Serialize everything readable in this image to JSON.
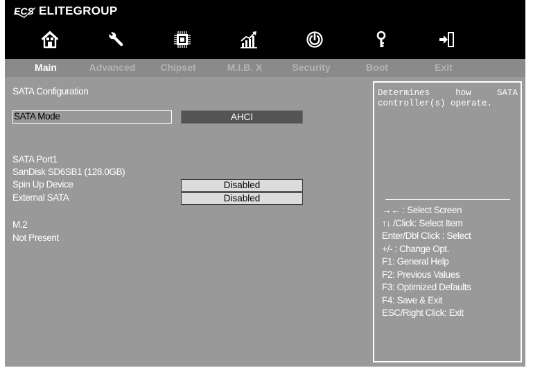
{
  "brand": {
    "name": "ELITEGROUP",
    "logo_text": "ECS"
  },
  "nav_icons": [
    {
      "name": "home-icon",
      "tab": "Main"
    },
    {
      "name": "wrench-icon",
      "tab": "Advanced"
    },
    {
      "name": "chip-icon",
      "tab": "Chipset"
    },
    {
      "name": "chart-icon",
      "tab": "M.I.B. X"
    },
    {
      "name": "power-icon",
      "tab": "Security"
    },
    {
      "name": "key-icon",
      "tab": "Boot"
    },
    {
      "name": "exit-icon",
      "tab": "Exit"
    }
  ],
  "tabs": [
    {
      "label": "Main",
      "active": true
    },
    {
      "label": "Advanced",
      "active": false
    },
    {
      "label": "Chipset",
      "active": false
    },
    {
      "label": "M.I.B. X",
      "active": false
    },
    {
      "label": "Security",
      "active": false
    },
    {
      "label": "Boot",
      "active": false
    },
    {
      "label": "Exit",
      "active": false
    }
  ],
  "content": {
    "section_title": "SATA Configuration",
    "sata_mode": {
      "label": "SATA Mode",
      "value": "AHCI"
    },
    "port1": {
      "label": "SATA Port1",
      "device": "SanDisk SD6SB1 (128.0GB)",
      "spin_up": {
        "label": "Spin Up Device",
        "value": "Disabled"
      },
      "external": {
        "label": "External SATA",
        "value": "Disabled"
      }
    },
    "m2": {
      "label": "M.2",
      "status": "Not Present"
    }
  },
  "help": {
    "description": "Determines how SATA controller(s) operate.",
    "keys": [
      "→← : Select Screen",
      "↑↓ /Click: Select Item",
      "Enter/Dbl Click : Select",
      " +/- : Change Opt.",
      "F1: General Help",
      "F2: Previous Values",
      "F3: Optimized Defaults",
      "F4: Save & Exit",
      "ESC/Right Click: Exit"
    ]
  },
  "colors": {
    "background": "#999999",
    "topbar": "#000000",
    "tabbar": "#8a8a8a",
    "text": "#ffffff",
    "tab_inactive": "#b3b3b3",
    "selected_value_box": "#545454",
    "value_box": "#dcdcdc"
  }
}
